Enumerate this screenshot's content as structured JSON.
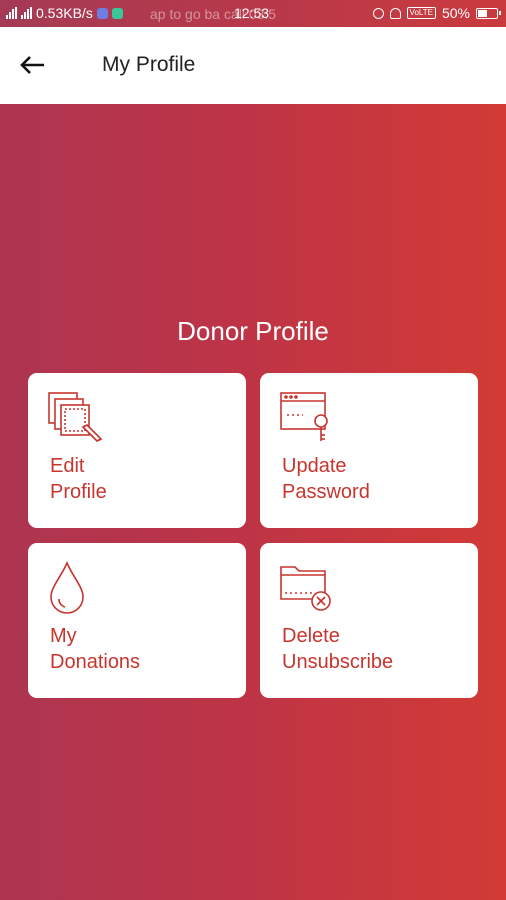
{
  "status_bar": {
    "speed": "0.53KB/s",
    "ghost_text": "ap to go ba    call   03:5",
    "time": "12:53",
    "volte": "VoLTE",
    "battery": "50%",
    "battery_level": 0.5
  },
  "app_bar": {
    "back_icon": "back-arrow-icon",
    "title": "My Profile"
  },
  "main": {
    "section_title": "Donor Profile",
    "cards": [
      {
        "icon": "edit-pages-icon",
        "line1": "Edit",
        "line2": "Profile"
      },
      {
        "icon": "password-window-key-icon",
        "line1": "Update",
        "line2": "Password"
      },
      {
        "icon": "blood-drop-icon",
        "line1": "My",
        "line2": "Donations"
      },
      {
        "icon": "folder-delete-icon",
        "line1": "Delete",
        "line2": "Unsubscribe"
      }
    ]
  },
  "colors": {
    "gradient_start": "#ad3550",
    "gradient_end": "#d23a35",
    "accent": "#c8352e",
    "card_bg": "#ffffff"
  }
}
